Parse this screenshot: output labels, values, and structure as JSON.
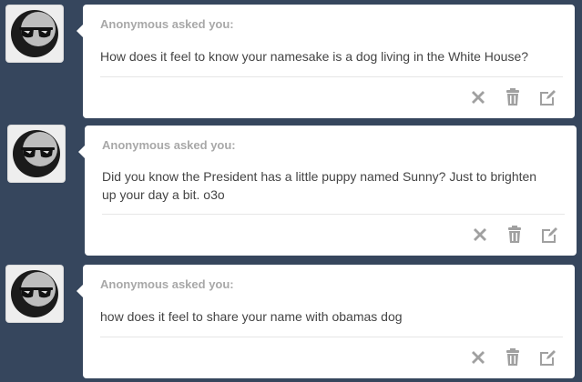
{
  "messages": [
    {
      "asker": "Anonymous asked you:",
      "question": "How does it feel to know your namesake is a dog living in the White House?",
      "actions": {
        "delete_icon": "close-x-icon",
        "trash_icon": "trash-icon",
        "edit_icon": "edit-icon"
      }
    },
    {
      "asker": "Anonymous asked you:",
      "question": "Did you know the President has a little puppy named Sunny? Just to brighten\nup your day a bit. o3o",
      "actions": {
        "delete_icon": "close-x-icon",
        "trash_icon": "trash-icon",
        "edit_icon": "edit-icon"
      }
    },
    {
      "asker": "Anonymous asked you:",
      "question": "how does it feel to share your name with obamas dog",
      "actions": {
        "delete_icon": "close-x-icon",
        "trash_icon": "trash-icon",
        "edit_icon": "edit-icon"
      }
    }
  ],
  "colors": {
    "background": "#36465d",
    "card": "#ffffff",
    "asker_text": "#a8a8a8",
    "question_text": "#444444",
    "icon": "#a0a0a0"
  }
}
